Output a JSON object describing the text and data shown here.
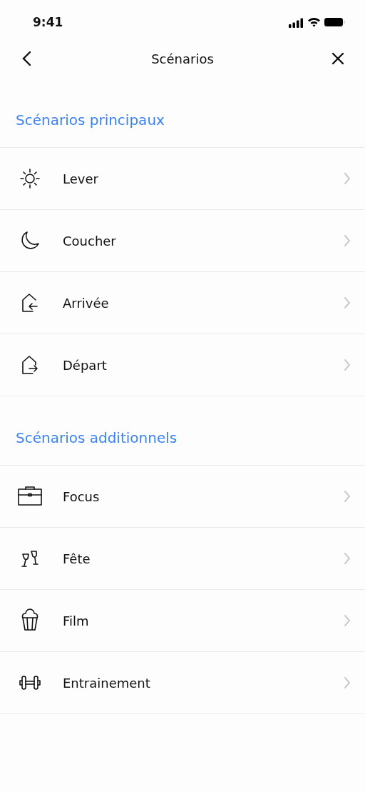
{
  "status_bar": {
    "time": "9:41"
  },
  "header": {
    "title": "Scénarios"
  },
  "sections": [
    {
      "title": "Scénarios principaux",
      "items": [
        {
          "label": "Lever",
          "kind": "sun"
        },
        {
          "label": "Coucher",
          "kind": "moon"
        },
        {
          "label": "Arrivée",
          "kind": "arrive"
        },
        {
          "label": "Départ",
          "kind": "depart"
        }
      ]
    },
    {
      "title": "Scénarios additionnels",
      "items": [
        {
          "label": "Focus",
          "kind": "briefcase"
        },
        {
          "label": "Fête",
          "kind": "glasses"
        },
        {
          "label": "Film",
          "kind": "popcorn"
        },
        {
          "label": "Entrainement",
          "kind": "dumbbell"
        }
      ]
    }
  ]
}
